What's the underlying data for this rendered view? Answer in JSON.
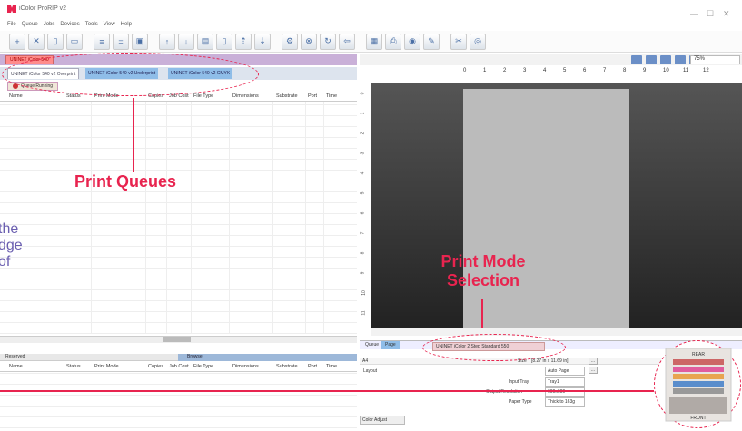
{
  "app": {
    "title": "iColor ProRIP v2",
    "menu": [
      "File",
      "Queue",
      "Jobs",
      "Devices",
      "Tools",
      "View",
      "Help"
    ],
    "window_controls": [
      "—",
      "☐",
      "✕"
    ]
  },
  "printer": {
    "name": "UNINET iColor 540"
  },
  "queue_tabs": [
    "UNINET iColor 540 v2 Overprint",
    "UNINET iColor 540 v2 Underprint",
    "UNINET iColor 540 v2 CMYK"
  ],
  "queue_status": "Queue Running",
  "columns": [
    "Name",
    "Status",
    "Print Mode",
    "Copies",
    "Job Cost",
    "File Type",
    "Dimensions",
    "Substrate",
    "Port",
    "Time"
  ],
  "reserved_label": "Reserved",
  "browse_label": "Browse",
  "zoom": "75%",
  "ruler_labels": [
    "0",
    "1",
    "2",
    "3",
    "4",
    "5",
    "6",
    "7",
    "8",
    "9",
    "10",
    "11",
    "12"
  ],
  "vruler_labels": [
    "0",
    "1",
    "2",
    "3",
    "4",
    "5",
    "6",
    "7",
    "8",
    "9",
    "10",
    "11"
  ],
  "bottom": {
    "tabs": [
      "Queue",
      "Page"
    ],
    "mode": "UNINET iColor 2 Step Standard 550",
    "paper_size": "A4",
    "size_label": "Size",
    "size_value": "[8.27 in x 11.69 in]",
    "layout_label": "Layout",
    "layout_value": "Auto Page",
    "input_tray_label": "Input Tray",
    "input_tray": "Tray1",
    "resolution_label": "Output Resolution",
    "resolution": "600x600",
    "paper_type_label": "Paper Type",
    "paper_type": "Thick to 163g",
    "color_adjust": "Color Adjust",
    "more": "..."
  },
  "annotations": {
    "queues": "Print Queues",
    "mode_line1": "Print Mode",
    "mode_line2": "Selection",
    "side_text": [
      "the",
      "dge",
      "of"
    ]
  },
  "printer_graphic": {
    "rear": "REAR",
    "front": "FRONT"
  },
  "colors": {
    "accent": "#e8244f",
    "queue_active": "#8fbde8",
    "mode_bg": "#f0d0d5"
  }
}
